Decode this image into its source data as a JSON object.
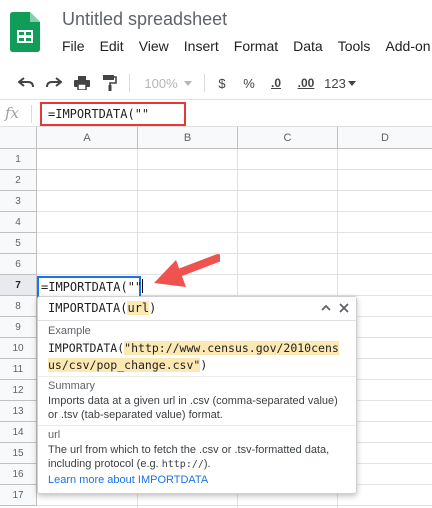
{
  "document": {
    "title": "Untitled spreadsheet"
  },
  "menu": [
    "File",
    "Edit",
    "View",
    "Insert",
    "Format",
    "Data",
    "Tools",
    "Add-on"
  ],
  "toolbar": {
    "zoom": "100%",
    "currency": "$",
    "percent": "%",
    "decrease_decimal": ".0",
    "increase_decimal": ".00",
    "more_formats": "123"
  },
  "formula_bar": {
    "fx_label": "fx",
    "value": "=IMPORTDATA(\"\""
  },
  "columns": [
    "A",
    "B",
    "C",
    "D"
  ],
  "rows": [
    "1",
    "2",
    "3",
    "4",
    "5",
    "6",
    "7",
    "8",
    "9",
    "10",
    "11",
    "12",
    "13",
    "14",
    "15",
    "16",
    "17"
  ],
  "active_cell": {
    "value": "=IMPORTDATA(\"\"",
    "row": "7",
    "column": "A"
  },
  "tooltip": {
    "signature_fn": "IMPORTDATA(",
    "signature_arg": "url",
    "signature_close": ")",
    "example_label": "Example",
    "example_fn": "IMPORTDATA(",
    "example_arg_line1": "\"http://www.census.gov/2010cens",
    "example_arg_line2": "us/csv/pop_change.csv\"",
    "example_close": ")",
    "summary_label": "Summary",
    "summary_text": "Imports data at a given url in .csv (comma-separated value) or .tsv (tab-separated value) format.",
    "param_name": "url",
    "param_desc": "The url from which to fetch the .csv or .tsv-formatted data, including protocol (e.g. ",
    "param_code": "http://",
    "param_end": ").",
    "learn_more": "Learn more about IMPORTDATA"
  },
  "colors": {
    "highlight_box": "#e53935",
    "active_cell_border": "#1a73e8",
    "arrow": "#ef5350",
    "link": "#1a73e8",
    "arg_highlight": "#fce8b2"
  }
}
